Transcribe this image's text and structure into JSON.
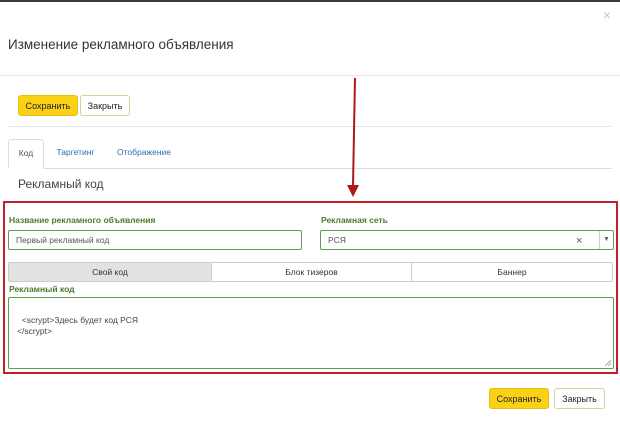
{
  "modal": {
    "title": "Изменение рекламного объявления",
    "close_glyph": "×"
  },
  "toolbar": {
    "save_label": "Сохранить",
    "close_label": "Закрыть"
  },
  "tabs": [
    {
      "label": "Код",
      "active": true
    },
    {
      "label": "Таргетинг",
      "active": false
    },
    {
      "label": "Отображение",
      "active": false
    }
  ],
  "section": {
    "title": "Рекламный код"
  },
  "form": {
    "name_label": "Название рекламного объявления",
    "name_value": "Первый рекламный код",
    "network_label": "Рекламная сеть",
    "network_value": "РСЯ",
    "clear_glyph": "×",
    "caret_glyph": "▼",
    "code_types": [
      {
        "label": "Свой код",
        "active": true
      },
      {
        "label": "Блок тизеров",
        "active": false
      },
      {
        "label": "Баннер",
        "active": false
      }
    ],
    "code_label": "Рекламный код",
    "code_value": "<scrypt>Здесь будет код РСЯ\n</scrypt>"
  },
  "footer": {
    "save_label": "Сохранить",
    "close_label": "Закрыть"
  },
  "colors": {
    "primary": "#f9d117",
    "highlight_frame": "#c0202a",
    "label_green": "#4d7a2a",
    "link_blue": "#2b6cb0"
  }
}
